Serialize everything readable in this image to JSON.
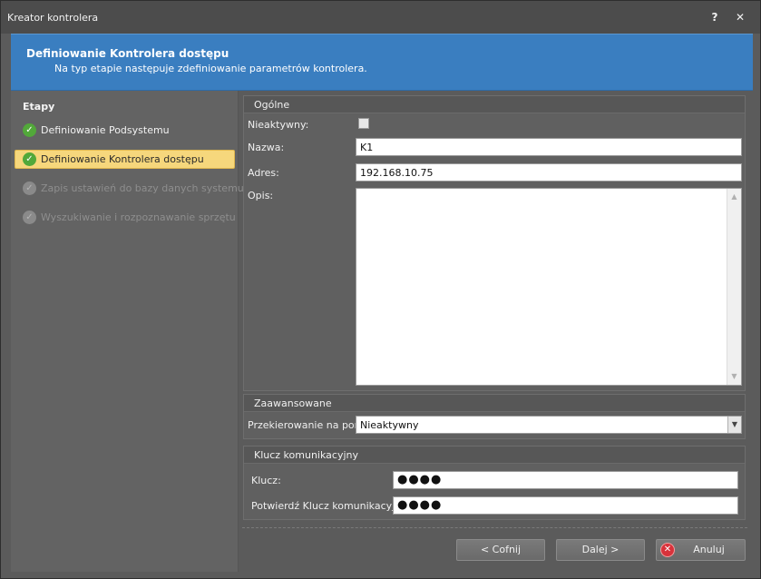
{
  "window": {
    "title": "Kreator kontrolera",
    "help_label": "?",
    "close_label": "✕"
  },
  "header": {
    "title": "Definiowanie Kontrolera dostępu",
    "subtitle": "Na typ etapie następuje zdefiniowanie parametrów kontrolera."
  },
  "steps": {
    "heading": "Etapy",
    "items": [
      {
        "label": "Definiowanie Podsystemu",
        "state": "done"
      },
      {
        "label": "Definiowanie Kontrolera dostępu",
        "state": "active"
      },
      {
        "label": "Zapis ustawień do bazy danych systemu",
        "state": "disabled"
      },
      {
        "label": "Wyszukiwanie i rozpoznawanie sprzętu",
        "state": "disabled"
      }
    ]
  },
  "general": {
    "heading": "Ogólne",
    "inactive_label": "Nieaktywny:",
    "inactive_checked": false,
    "name_label": "Nazwa:",
    "name_value": "K1",
    "address_label": "Adres:",
    "address_value": "192.168.10.75",
    "description_label": "Opis:",
    "description_value": ""
  },
  "advanced": {
    "heading": "Zaawansowane",
    "port_label": "Przekierowanie na port:",
    "port_value": "Nieaktywny"
  },
  "key": {
    "heading": "Klucz komunikacyjny",
    "key_label": "Klucz:",
    "key_value": "●●●●",
    "confirm_label": "Potwierdź Klucz komunikacyjny:",
    "confirm_value": "●●●●"
  },
  "buttons": {
    "back": "< Cofnij",
    "next": "Dalej >",
    "cancel": "Anuluj"
  },
  "icons": {
    "check": "check-circle-icon",
    "cancel": "cancel-circle-icon",
    "help": "help-icon",
    "close": "close-icon"
  },
  "colors": {
    "header_bg": "#3a7ec0",
    "active_step_bg": "#f6d77c",
    "check_green": "#52a83a",
    "cancel_red": "#d8323b"
  }
}
